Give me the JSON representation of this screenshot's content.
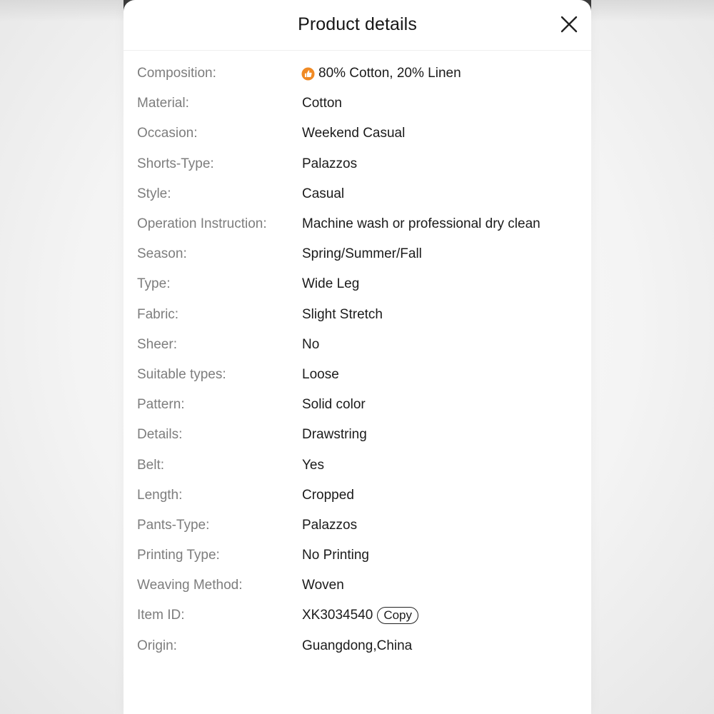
{
  "header": {
    "title": "Product details"
  },
  "icons": {
    "close": "close-icon",
    "composition": "thumbs-up-badge-icon"
  },
  "colors": {
    "label": "#7d7d7d",
    "value": "#1b1b1b",
    "accent_orange": "#f08a24"
  },
  "details": [
    {
      "label": "Composition:",
      "value": "80% Cotton, 20% Linen"
    },
    {
      "label": "Material:",
      "value": "Cotton"
    },
    {
      "label": "Occasion:",
      "value": "Weekend Casual"
    },
    {
      "label": "Shorts-Type:",
      "value": "Palazzos"
    },
    {
      "label": "Style:",
      "value": "Casual"
    },
    {
      "label": "Operation Instruction:",
      "value": "Machine wash or professional dry clean"
    },
    {
      "label": "Season:",
      "value": "Spring/Summer/Fall"
    },
    {
      "label": "Type:",
      "value": "Wide Leg"
    },
    {
      "label": "Fabric:",
      "value": "Slight Stretch"
    },
    {
      "label": "Sheer:",
      "value": "No"
    },
    {
      "label": "Suitable types:",
      "value": "Loose"
    },
    {
      "label": "Pattern:",
      "value": "Solid color"
    },
    {
      "label": "Details:",
      "value": "Drawstring"
    },
    {
      "label": "Belt:",
      "value": "Yes"
    },
    {
      "label": "Length:",
      "value": "Cropped"
    },
    {
      "label": "Pants-Type:",
      "value": "Palazzos"
    },
    {
      "label": "Printing Type:",
      "value": "No Printing"
    },
    {
      "label": "Weaving Method:",
      "value": "Woven"
    },
    {
      "label": "Item ID:",
      "value": "XK3034540"
    },
    {
      "label": "Origin:",
      "value": "Guangdong,China"
    }
  ],
  "copy_label": "Copy"
}
